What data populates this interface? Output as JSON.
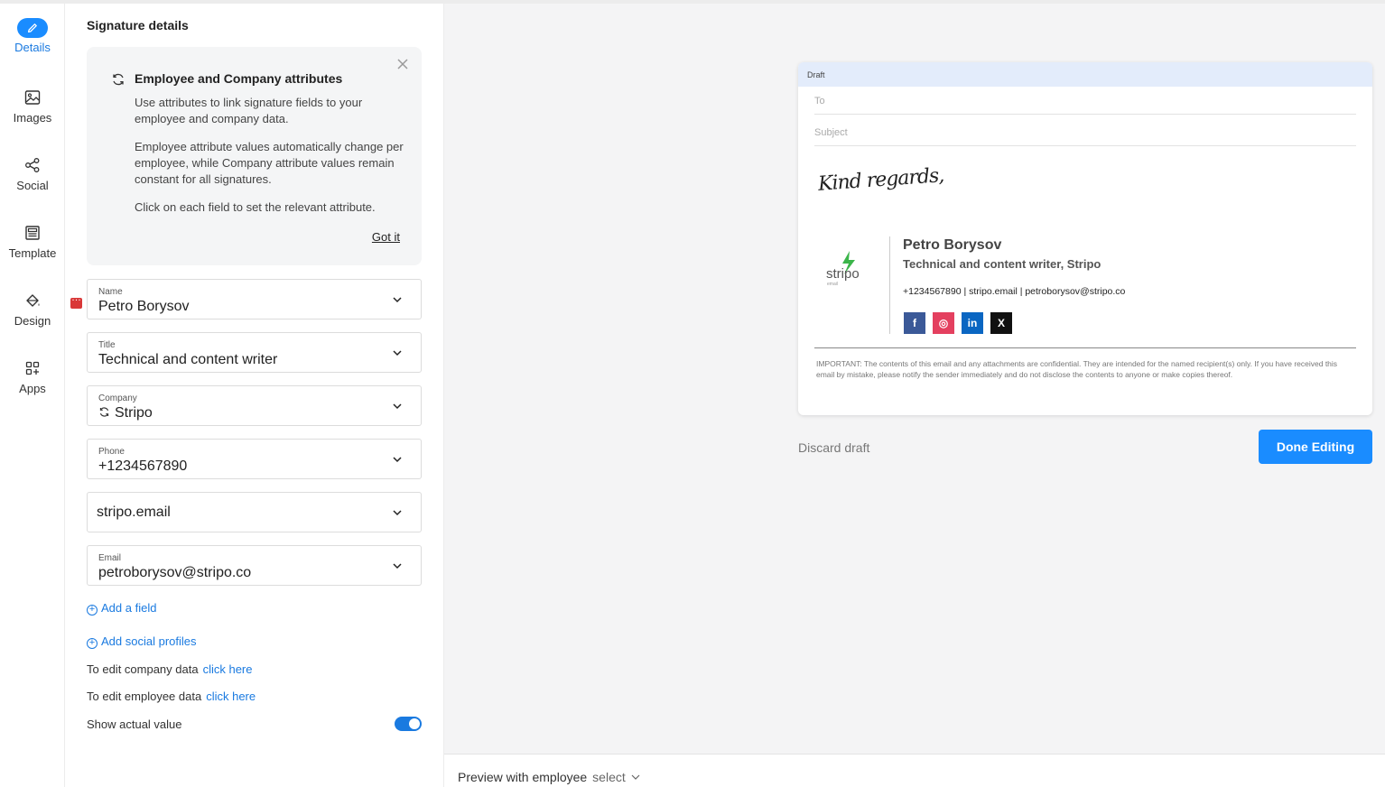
{
  "nav": {
    "items": [
      {
        "label": "Details",
        "icon": "pencil-icon",
        "active": true
      },
      {
        "label": "Images",
        "icon": "image-icon"
      },
      {
        "label": "Social",
        "icon": "share-icon"
      },
      {
        "label": "Template",
        "icon": "template-icon"
      },
      {
        "label": "Design",
        "icon": "paint-bucket-icon"
      },
      {
        "label": "Apps",
        "icon": "apps-grid-icon"
      }
    ]
  },
  "panel": {
    "title": "Signature details",
    "info": {
      "title": "Employee and Company attributes",
      "p1": "Use attributes to link signature fields to your employee and company data.",
      "p2": "Employee attribute values automatically change per employee, while Company attribute values remain constant for all signatures.",
      "p3": "Click on each field to set the relevant attribute.",
      "got_it": "Got it"
    },
    "fields": [
      {
        "label": "Name",
        "value": "Petro Borysov"
      },
      {
        "label": "Title",
        "value": "Technical and content writer"
      },
      {
        "label": "Company",
        "value": "Stripo"
      },
      {
        "label": "Phone",
        "value": "+1234567890"
      },
      {
        "label": "",
        "value": "stripo.email"
      },
      {
        "label": "Email",
        "value": "petroborysov@stripo.co"
      }
    ],
    "add_field": "Add a field",
    "add_social": "Add social profiles",
    "edit_company": "To edit company data",
    "edit_employee": "To edit employee data",
    "click_here": "click here",
    "show_actual": "Show actual value",
    "show_actual_on": true
  },
  "preview": {
    "draft_label": "Draft",
    "to_placeholder": "To",
    "subject_placeholder": "Subject",
    "closing": "Kind regards,",
    "logo_text": "stripo",
    "logo_sub": "email",
    "sig_name": "Petro Borysov",
    "sig_title": "Technical and content writer, Stripo",
    "sig_contacts": "+1234567890  |  stripo.email  |  petroborysov@stripo.co",
    "socials": [
      {
        "glyph": "f",
        "icon": "facebook-icon",
        "color": "#3b5998"
      },
      {
        "glyph": "◎",
        "icon": "instagram-icon",
        "color": "#e4405f"
      },
      {
        "glyph": "in",
        "icon": "linkedin-icon",
        "color": "#0a66c2"
      },
      {
        "glyph": "X",
        "icon": "x-icon",
        "color": "#111111"
      }
    ],
    "disclaimer": "IMPORTANT: The contents of this email and any attachments are confidential. They are intended for the named recipient(s) only. If you have received this email by mistake, please notify the sender immediately and do not disclose the contents to anyone or make copies thereof.",
    "discard": "Discard draft",
    "done": "Done Editing"
  },
  "bottom": {
    "preview_label": "Preview with employee",
    "select": "select"
  },
  "colors": {
    "accent": "#1a8cff",
    "link": "#1a7ae0",
    "logo_green": "#3bb54a"
  }
}
